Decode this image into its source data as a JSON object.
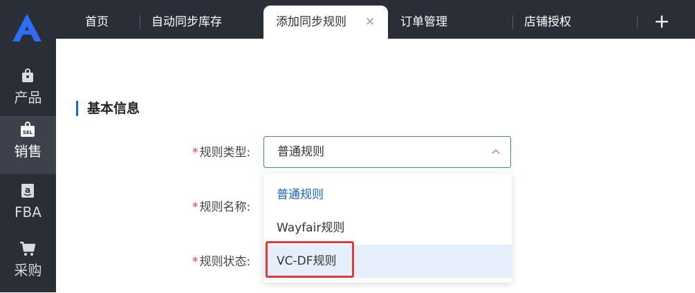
{
  "sidebar": {
    "logo": "a-logo-icon",
    "items": [
      {
        "label": "产品",
        "icon": "bag-icon"
      },
      {
        "label": "销售",
        "icon": "sell-tag-icon",
        "active": true
      },
      {
        "label": "FBA",
        "icon": "amazon-icon"
      },
      {
        "label": "采购",
        "icon": "cart-icon"
      }
    ]
  },
  "tabs": [
    {
      "label": "首页"
    },
    {
      "label": "自动同步库存"
    },
    {
      "label": "添加同步规则",
      "active": true,
      "close": "✕"
    },
    {
      "label": "订单管理"
    },
    {
      "label": "店铺授权"
    }
  ],
  "add_tab": "+",
  "section": {
    "title": "基本信息"
  },
  "form": {
    "required_mark": "*",
    "rule_type_label": "规则类型:",
    "rule_name_label": "规则名称:",
    "rule_status_label": "规则状态:",
    "rule_type_value": "普通规则"
  },
  "dropdown": {
    "options": [
      {
        "label": "普通规则",
        "state": "selected"
      },
      {
        "label": "Wayfair规则"
      },
      {
        "label": "VC-DF规则",
        "state": "hover"
      }
    ]
  },
  "colors": {
    "accent": "#1a64d6",
    "sidebar": "#2a2e37",
    "highlight": "#e03a3a",
    "required": "#e53935"
  }
}
